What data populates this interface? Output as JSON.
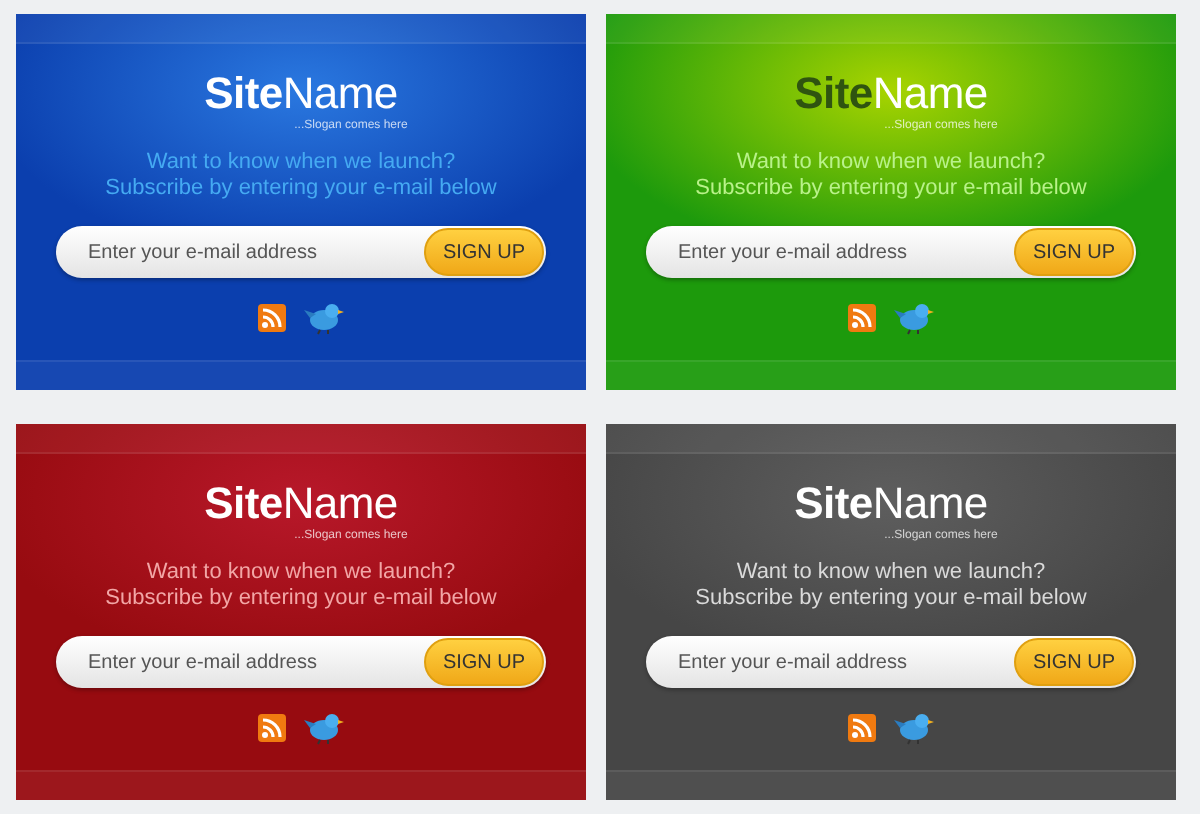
{
  "cards": [
    {
      "kind": "blue",
      "title_bold": "Site",
      "title_regular": "Name",
      "slogan": "...Slogan comes here",
      "message": [
        "Want to know when we launch?",
        "Subscribe by entering your e-mail below"
      ],
      "email": {
        "placeholder": "Enter your e-mail address"
      },
      "button": "SIGN UP",
      "color": "#0b3fae"
    },
    {
      "kind": "green",
      "title_bold": "Site",
      "title_regular": "Name",
      "slogan": "...Slogan comes here",
      "message": [
        "Want to know when we launch?",
        "Subscribe by entering your e-mail below"
      ],
      "email": {
        "placeholder": "Enter your e-mail address"
      },
      "button": "SIGN UP",
      "color": "#1d9a0c"
    },
    {
      "kind": "red",
      "title_bold": "Site",
      "title_regular": "Name",
      "slogan": "...Slogan comes here",
      "message": [
        "Want to know when we launch?",
        "Subscribe by entering your e-mail below"
      ],
      "email": {
        "placeholder": "Enter your e-mail address"
      },
      "button": "SIGN UP",
      "color": "#970b10"
    },
    {
      "kind": "grey",
      "title_bold": "Site",
      "title_regular": "Name",
      "slogan": "...Slogan comes here",
      "message": [
        "Want to know when we launch?",
        "Subscribe by entering your e-mail below"
      ],
      "email": {
        "placeholder": "Enter your e-mail address"
      },
      "button": "SIGN UP",
      "color": "#464646"
    }
  ]
}
